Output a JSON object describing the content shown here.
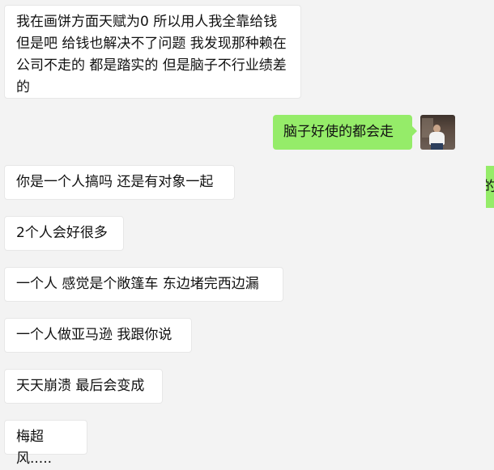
{
  "messages": [
    {
      "side": "left",
      "text": "我在画饼方面天赋为0  所以用人我全靠给钱 但是吧 给钱也解决不了问题 我发现那种赖在公司不走的 都是踏实的 但是脑子不行业绩差的"
    },
    {
      "side": "right",
      "text": "脑子好使的都会走"
    },
    {
      "side": "left",
      "text": "你是一个人搞吗 还是有对象一起"
    },
    {
      "side": "left",
      "text": "2个人会好很多"
    },
    {
      "side": "left",
      "text": "一个人 感觉是个敞篷车 东边堵完西边漏"
    },
    {
      "side": "left",
      "text": "一个人做亚马逊 我跟你说"
    },
    {
      "side": "left",
      "text": "天天崩溃 最后会变成"
    },
    {
      "side": "left",
      "text": "梅超风....."
    }
  ],
  "side_tab": {
    "text": "的"
  },
  "colors": {
    "background": "#f3f3f3",
    "left_bubble": "#ffffff",
    "right_bubble": "#95ec69"
  }
}
